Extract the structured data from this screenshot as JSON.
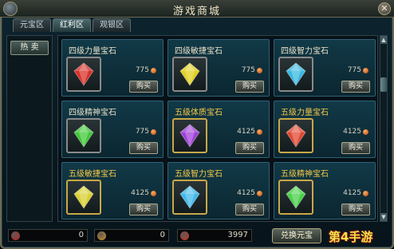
{
  "window": {
    "title": "游戏商城",
    "close_label": "✕"
  },
  "tabs": [
    {
      "label": "元宝区",
      "active": false
    },
    {
      "label": "红利区",
      "active": true
    },
    {
      "label": "观银区",
      "active": false
    }
  ],
  "sidebar": {
    "hot_label": "热 卖"
  },
  "items": [
    {
      "name": "四级力量宝石",
      "name_color": "#e8e0c8",
      "price": "775",
      "buy_label": "购买",
      "gem_color": "#d8302a",
      "frame": "gray"
    },
    {
      "name": "四级敏捷宝石",
      "name_color": "#e8e0c8",
      "price": "775",
      "buy_label": "购买",
      "gem_color": "#e0d020",
      "frame": "gray"
    },
    {
      "name": "四级智力宝石",
      "name_color": "#e8e0c8",
      "price": "775",
      "buy_label": "购买",
      "gem_color": "#38b8e0",
      "frame": "gray"
    },
    {
      "name": "四级精神宝石",
      "name_color": "#e8e0c8",
      "price": "775",
      "buy_label": "购买",
      "gem_color": "#40c838",
      "frame": "gray"
    },
    {
      "name": "五级体质宝石",
      "name_color": "#f4c848",
      "price": "4125",
      "buy_label": "购买",
      "gem_color": "#a040d8",
      "frame": "gold"
    },
    {
      "name": "五级力量宝石",
      "name_color": "#f4c848",
      "price": "4125",
      "buy_label": "购买",
      "gem_color": "#e04830",
      "frame": "gold"
    },
    {
      "name": "五级敏捷宝石",
      "name_color": "#f4c848",
      "price": "4125",
      "buy_label": "购买",
      "gem_color": "#d8d030",
      "frame": "gold"
    },
    {
      "name": "五级智力宝石",
      "name_color": "#f4c848",
      "price": "4125",
      "buy_label": "购买",
      "gem_color": "#40b8e8",
      "frame": "gold"
    },
    {
      "name": "五级精神宝石",
      "name_color": "#f4c848",
      "price": "4125",
      "buy_label": "购买",
      "gem_color": "#48d048",
      "frame": "gold"
    }
  ],
  "currencies": [
    {
      "icon": "red-gem-icon",
      "value": "0",
      "color": "#c02020"
    },
    {
      "icon": "gold-coin-icon",
      "value": "0",
      "color": "#d89020"
    },
    {
      "icon": "red-token-icon",
      "value": "3997",
      "color": "#d03018"
    }
  ],
  "exchange_label": "兑换元宝",
  "watermark": "第4手游"
}
